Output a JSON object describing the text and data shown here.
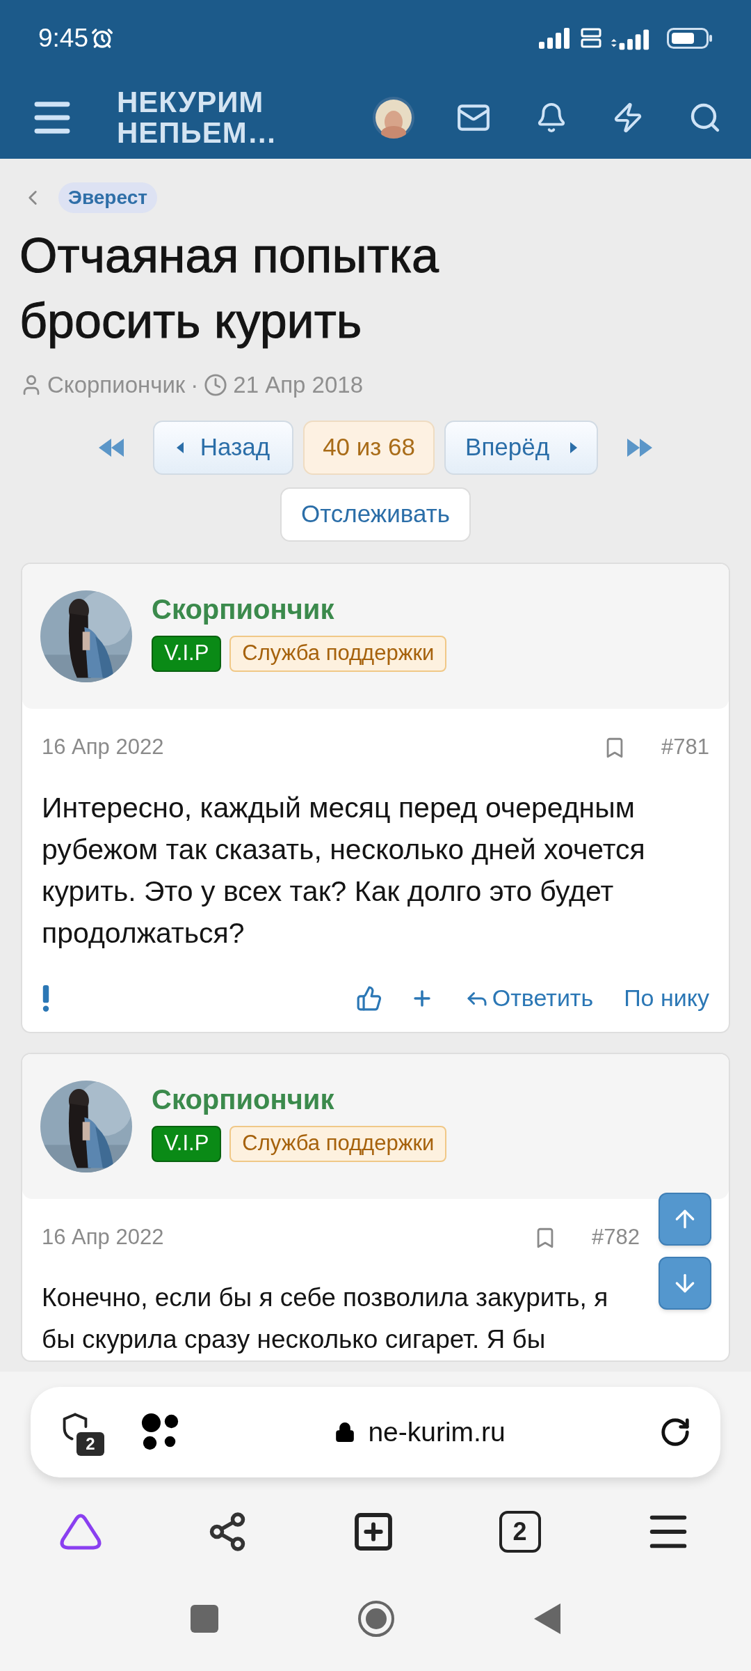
{
  "status_bar": {
    "time": "9:45"
  },
  "header": {
    "logo_lines": [
      "НЕКУРИМ",
      "НЕПЬЕМ…"
    ]
  },
  "breadcrumb": {
    "label": "Эверест"
  },
  "thread": {
    "title": "Отчаяная попытка бросить курить",
    "author": "Скорпиончик",
    "separator": "·",
    "date": "21 Апр 2018"
  },
  "pagination": {
    "prev": "Назад",
    "current": "40 из 68",
    "next": "Вперёд"
  },
  "watch_button": "Отслеживать",
  "posts": [
    {
      "author": "Скорпиончик",
      "badges": [
        {
          "kind": "vip",
          "text": "V.I.P"
        },
        {
          "kind": "staff",
          "text": "Служба поддержки"
        }
      ],
      "date": "16 Апр 2022",
      "number": "#781",
      "body": "Интересно, каждый месяц перед очередным рубежом так сказать, несколько дней хочется курить. Это у всех так? Как долго это будет продолжаться?",
      "actions": [
        "Ответить",
        "По нику"
      ]
    },
    {
      "author": "Скорпиончик",
      "badges": [
        {
          "kind": "vip",
          "text": "V.I.P"
        },
        {
          "kind": "staff",
          "text": "Служба поддержки"
        }
      ],
      "date": "16 Апр 2022",
      "number": "#782",
      "body": "Конечно, если бы я себе позволила закурить, я бы скурила сразу несколько сигарет. Я бы"
    }
  ],
  "browser": {
    "url": "ne-kurim.ru",
    "shield_count": "2",
    "tabs_count": "2"
  }
}
